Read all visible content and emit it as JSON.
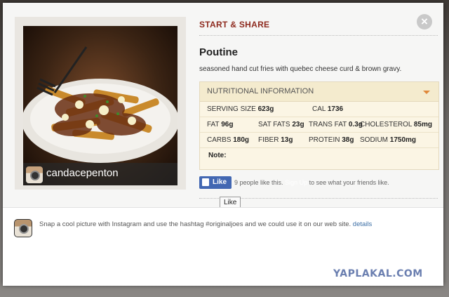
{
  "modal": {
    "close_glyph": "×",
    "section_heading": "START & SHARE",
    "item_title": "Poutine",
    "item_description": "seasoned hand cut fries with quebec cheese curd & brown gravy.",
    "photo_caption": "candacepenton"
  },
  "nutrition": {
    "header": "NUTRITIONAL INFORMATION",
    "serving_size": {
      "label": "SERVING SIZE",
      "value": "623g"
    },
    "cal": {
      "label": "CAL",
      "value": "1736"
    },
    "fat": {
      "label": "FAT",
      "value": "96g"
    },
    "sat_fats": {
      "label": "SAT FATS",
      "value": "23g"
    },
    "trans_fat": {
      "label": "TRANS FAT",
      "value": "0.3g"
    },
    "cholesterol": {
      "label": "CHOLESTEROL",
      "value": "85mg"
    },
    "carbs": {
      "label": "CARBS",
      "value": "180g"
    },
    "fiber": {
      "label": "FIBER",
      "value": "13g"
    },
    "protein": {
      "label": "PROTEIN",
      "value": "38g"
    },
    "sodium": {
      "label": "SODIUM",
      "value": "1750mg"
    },
    "note_label": "Note:"
  },
  "social": {
    "like_button": "Like",
    "like_count_text": "9 people like this.",
    "signup_text": "Sign Up",
    "signup_suffix": "to see what your friends like.",
    "tooltip": "Like"
  },
  "footer": {
    "text": "Snap a cool picture with Instagram and use the hashtag #originaljoes and we could use it on our web site.",
    "link": "details"
  },
  "watermark": "YAPLAKAL.COM",
  "colors": {
    "heading_red": "#8e2a1e",
    "facebook_blue": "#4267b2",
    "nutrition_bg": "#fbf5e4",
    "caret_orange": "#e0883a"
  }
}
